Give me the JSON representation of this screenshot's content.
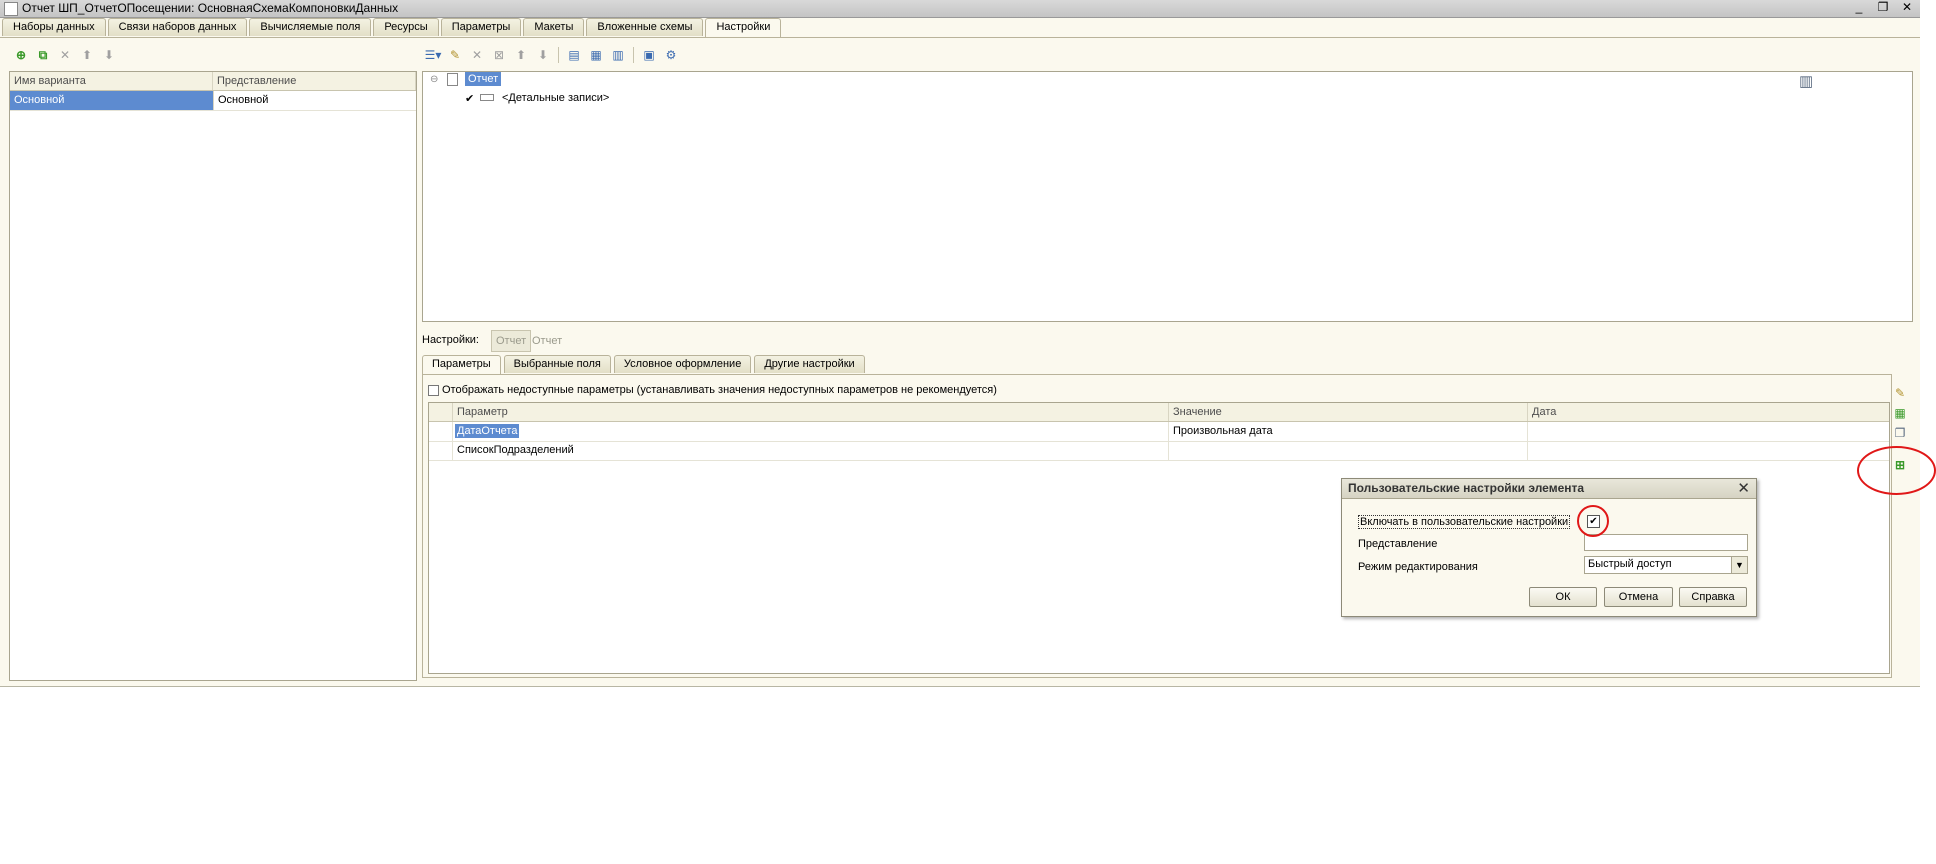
{
  "window": {
    "title": "Отчет ШП_ОтчетОПосещении: ОсновнаяСхемаКомпоновкиДанных",
    "minimize": "_",
    "restore": "❐",
    "close": "✕"
  },
  "tabs": [
    {
      "label": "Наборы данных"
    },
    {
      "label": "Связи наборов данных"
    },
    {
      "label": "Вычисляемые поля"
    },
    {
      "label": "Ресурсы"
    },
    {
      "label": "Параметры"
    },
    {
      "label": "Макеты"
    },
    {
      "label": "Вложенные схемы"
    },
    {
      "label": "Настройки"
    }
  ],
  "active_tab": "Настройки",
  "variants": {
    "columns": [
      "Имя варианта",
      "Представление"
    ],
    "rows": [
      {
        "name": "Основной",
        "presentation": "Основной"
      }
    ]
  },
  "structure": {
    "root": "Отчет",
    "child": "<Детальные записи>",
    "child_mark": "✔"
  },
  "settings": {
    "label": "Настройки:",
    "button": "Отчет",
    "current": "Отчет"
  },
  "subtabs": [
    {
      "label": "Параметры"
    },
    {
      "label": "Выбранные поля"
    },
    {
      "label": "Условное оформление"
    },
    {
      "label": "Другие настройки"
    }
  ],
  "show_unavailable": "Отображать недоступные параметры (устанавливать значения недоступных параметров не рекомендуется)",
  "params": {
    "columns": [
      "Параметр",
      "Значение",
      "Дата"
    ],
    "rows": [
      {
        "param": "ДатаОтчета",
        "value": "Произвольная дата",
        "date": ""
      },
      {
        "param": "СписокПодразделений",
        "value": "",
        "date": ""
      }
    ]
  },
  "dialog": {
    "title": "Пользовательские настройки элемента",
    "close": "✕",
    "include_label": "Включать в пользовательские настройки",
    "include_checked": true,
    "check_mark": "✔",
    "presentation_label": "Представление",
    "presentation_value": "",
    "mode_label": "Режим редактирования",
    "mode_value": "Быстрый доступ",
    "ok": "ОК",
    "cancel": "Отмена",
    "help": "Справка"
  },
  "colors": {
    "selection": "#5d8bd0",
    "highlight_circle": "#e01818",
    "panel_bg": "#fbf9ee"
  }
}
